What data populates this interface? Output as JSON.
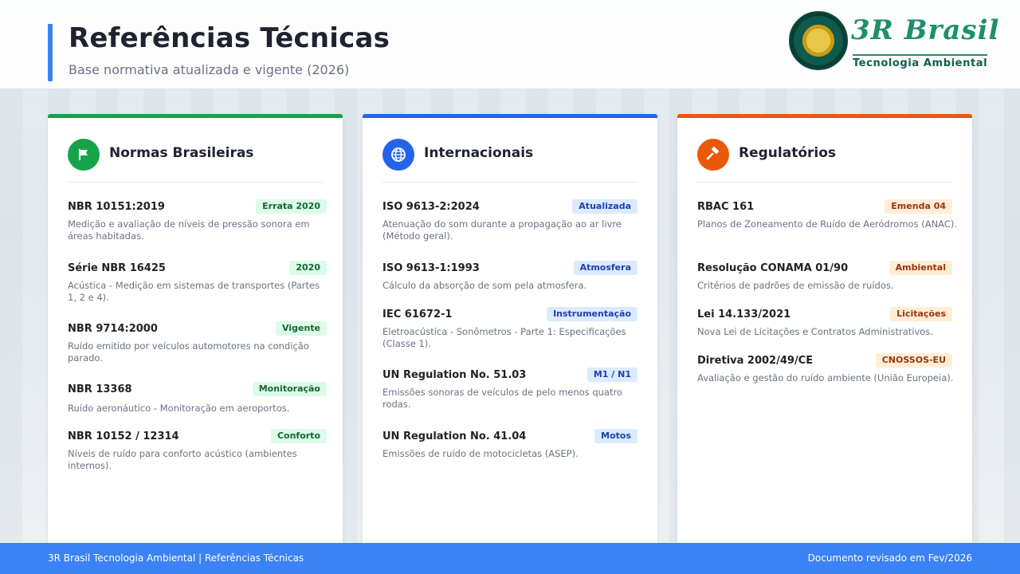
{
  "header": {
    "title": "Referências Técnicas",
    "subtitle": "Base normativa atualizada e vigente (2026)"
  },
  "logo": {
    "brand": "3R Brasil",
    "tagline": "Tecnologia Ambiental"
  },
  "colors": {
    "accent_blue": "#3b82f6",
    "green": "#16a34a",
    "blue": "#2563eb",
    "orange": "#ea580c"
  },
  "cards": [
    {
      "title": "Normas Brasileiras",
      "icon": "flag-icon",
      "entries": [
        {
          "code": "NBR 10151:2019",
          "badge": "Errata 2020",
          "desc": "Medição e avaliação de níveis de pressão sonora em áreas habitadas."
        },
        {
          "code": "Série NBR 16425",
          "badge": "2020",
          "desc": "Acústica - Medição em sistemas de transportes (Partes 1, 2 e 4)."
        },
        {
          "code": "NBR 9714:2000",
          "badge": "Vigente",
          "desc": "Ruído emitido por veículos automotores na condição parado."
        },
        {
          "code": "NBR 13368",
          "badge": "Monitoração",
          "desc": "Ruído aeronáutico - Monitoração em aeroportos."
        },
        {
          "code": "NBR 10152 / 12314",
          "badge": "Conforto",
          "desc": "Níveis de ruído para conforto acústico (ambientes internos)."
        }
      ]
    },
    {
      "title": "Internacionais",
      "icon": "globe-icon",
      "entries": [
        {
          "code": "ISO 9613-2:2024",
          "badge": "Atualizada",
          "desc": "Atenuação do som durante a propagação ao ar livre (Método geral)."
        },
        {
          "code": "ISO 9613-1:1993",
          "badge": "Atmosfera",
          "desc": "Cálculo da absorção de som pela atmosfera."
        },
        {
          "code": "IEC 61672-1",
          "badge": "Instrumentação",
          "desc": "Eletroacústica - Sonômetros - Parte 1: Especificações (Classe 1)."
        },
        {
          "code": "UN Regulation No. 51.03",
          "badge": "M1 / N1",
          "desc": "Emissões sonoras de veículos de pelo menos quatro rodas."
        },
        {
          "code": "UN Regulation No. 41.04",
          "badge": "Motos",
          "desc": "Emissões de ruído de motocicletas (ASEP)."
        }
      ]
    },
    {
      "title": "Regulatórios",
      "icon": "gavel-icon",
      "entries": [
        {
          "code": "RBAC 161",
          "badge": "Emenda 04",
          "desc": "Planos de Zoneamento de Ruído de Aeródromos (ANAC)."
        },
        {
          "code": "Resolução CONAMA 01/90",
          "badge": "Ambiental",
          "desc": "Critérios de padrões de emissão de ruídos."
        },
        {
          "code": "Lei 14.133/2021",
          "badge": "Licitações",
          "desc": "Nova Lei de Licitações e Contratos Administrativos."
        },
        {
          "code": "Diretiva 2002/49/CE",
          "badge": "CNOSSOS-EU",
          "desc": "Avaliação e gestão do ruído ambiente (União Europeia)."
        }
      ]
    }
  ],
  "footer": {
    "left": "3R Brasil Tecnologia Ambiental | Referências Técnicas",
    "right": "Documento revisado em Fev/2026"
  }
}
